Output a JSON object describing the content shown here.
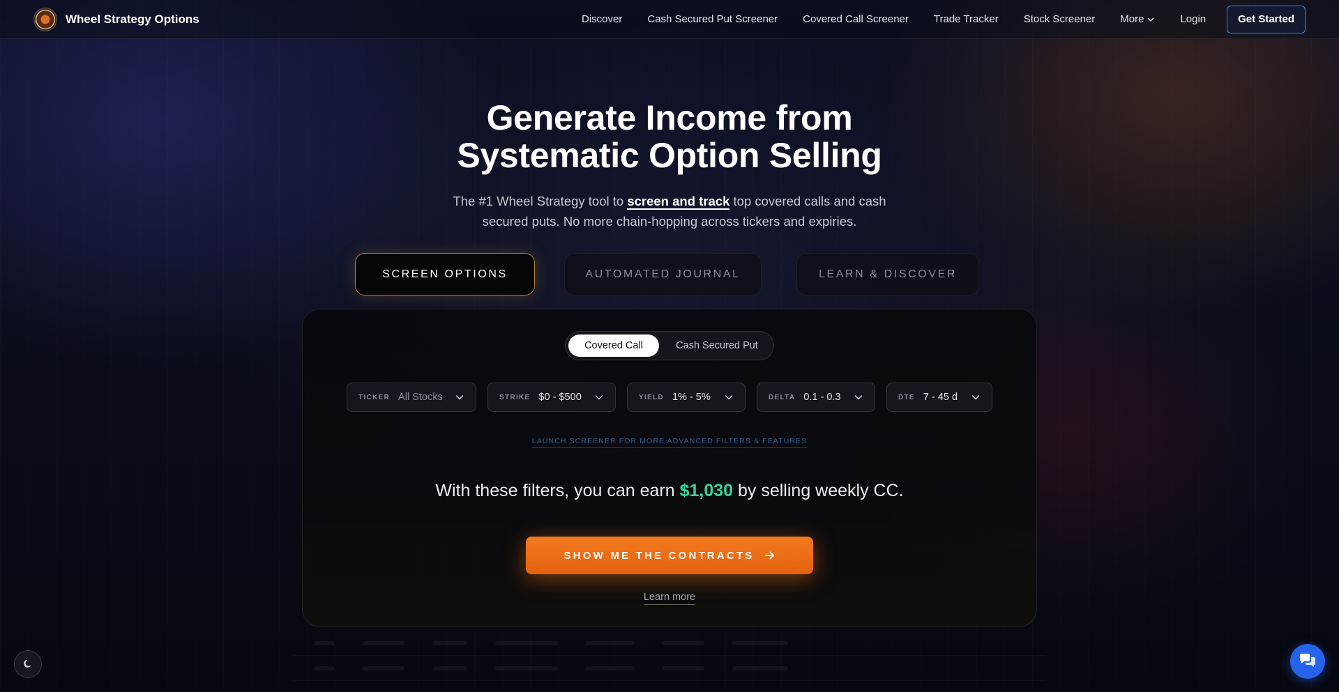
{
  "brand": {
    "name": "Wheel Strategy Options",
    "logo_icon": "wheel-logo-icon"
  },
  "nav": {
    "links": [
      {
        "label": "Discover"
      },
      {
        "label": "Cash Secured Put Screener"
      },
      {
        "label": "Covered Call Screener"
      },
      {
        "label": "Trade Tracker"
      },
      {
        "label": "Stock Screener"
      },
      {
        "label": "More"
      },
      {
        "label": "Login"
      }
    ],
    "cta_label": "Get Started"
  },
  "hero": {
    "title_line1": "Generate Income from",
    "title_line2": "Systematic Option Selling",
    "sub_before": "The #1 Wheel Strategy tool to ",
    "sub_bold": "screen and track",
    "sub_after": " top covered calls and cash secured puts. No more chain-hopping across tickers and expiries."
  },
  "feature_tabs": [
    {
      "label": "SCREEN OPTIONS",
      "active": true
    },
    {
      "label": "AUTOMATED JOURNAL",
      "active": false
    },
    {
      "label": "LEARN & DISCOVER",
      "active": false
    }
  ],
  "strategy_toggle": {
    "options": [
      "Covered Call",
      "Cash Secured Put"
    ],
    "selected": "Covered Call"
  },
  "filters": [
    {
      "key": "TICKER",
      "value": "All Stocks"
    },
    {
      "key": "STRIKE",
      "value": "$0 - $500"
    },
    {
      "key": "YIELD",
      "value": "1% - 5%"
    },
    {
      "key": "DELTA",
      "value": "0.1 - 0.3"
    },
    {
      "key": "DTE",
      "value": "7 - 45 d"
    }
  ],
  "launch_link": "LAUNCH SCREENER FOR MORE ADVANCED FILTERS & FEATURES",
  "earn": {
    "before": "With these filters, you can earn ",
    "amount": "$1,030",
    "after": " by selling weekly CC."
  },
  "cta_label": "SHOW ME THE CONTRACTS",
  "learn_more": "Learn more",
  "colors": {
    "accent_orange": "#f37a1f",
    "accent_green": "#34d399",
    "accent_blue": "#3b82f6",
    "active_tab_border": "#b7822d"
  }
}
